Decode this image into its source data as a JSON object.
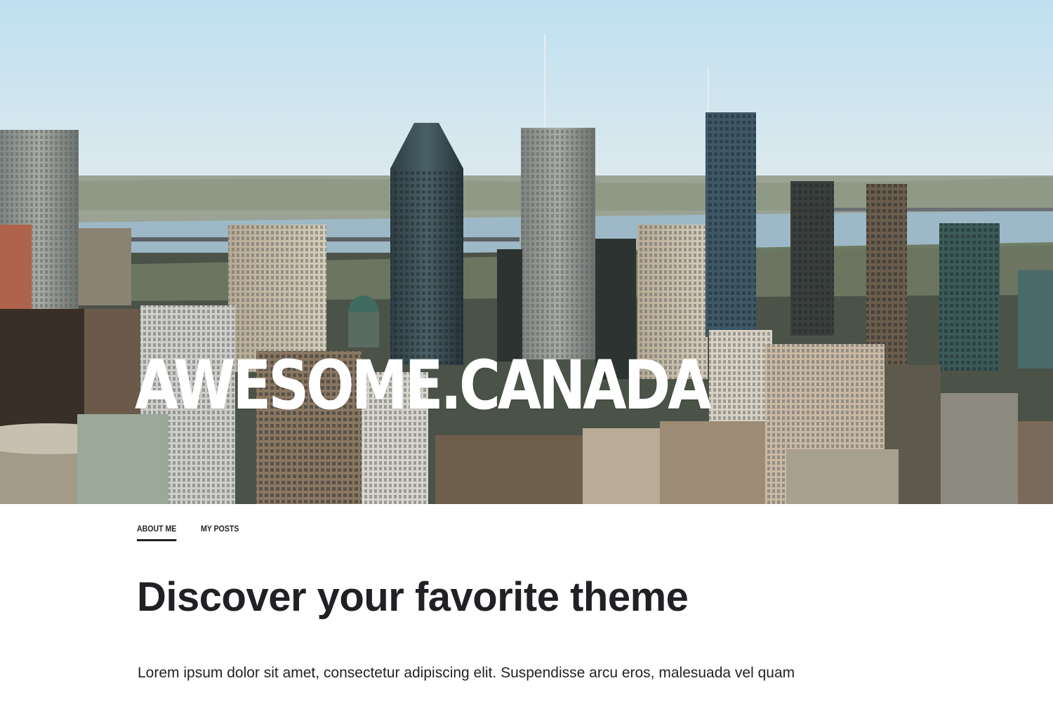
{
  "hero": {
    "site_title": "AWESOME.CANADA"
  },
  "nav": {
    "tabs": [
      {
        "label": "ABOUT ME",
        "active": true
      },
      {
        "label": "MY POSTS",
        "active": false
      }
    ]
  },
  "content": {
    "headline": "Discover your favorite theme",
    "paragraph": "Lorem ipsum dolor sit amet, consectetur adipiscing elit. Suspendisse arcu eros, malesuada vel quam"
  },
  "colors": {
    "text": "#1f2124",
    "background": "#ffffff",
    "hero_title": "#ffffff",
    "sky": "#c4e2f1",
    "river": "#9cb8c9"
  },
  "icons": []
}
